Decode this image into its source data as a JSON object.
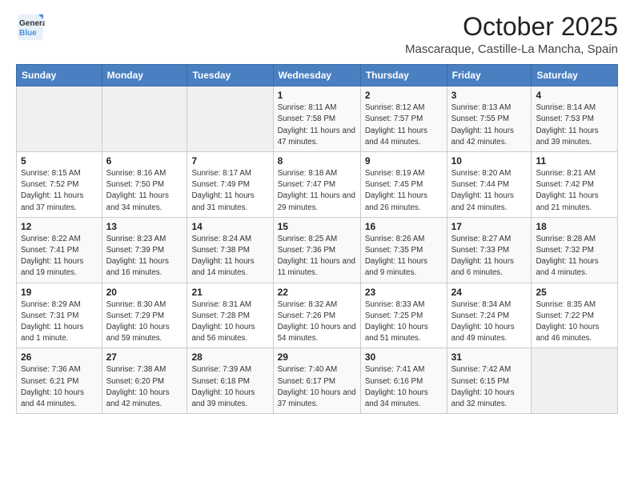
{
  "logo": {
    "line1": "General",
    "line2": "Blue"
  },
  "header": {
    "month": "October 2025",
    "location": "Mascaraque, Castille-La Mancha, Spain"
  },
  "weekdays": [
    "Sunday",
    "Monday",
    "Tuesday",
    "Wednesday",
    "Thursday",
    "Friday",
    "Saturday"
  ],
  "weeks": [
    [
      {
        "day": "",
        "info": ""
      },
      {
        "day": "",
        "info": ""
      },
      {
        "day": "",
        "info": ""
      },
      {
        "day": "1",
        "info": "Sunrise: 8:11 AM\nSunset: 7:58 PM\nDaylight: 11 hours and 47 minutes."
      },
      {
        "day": "2",
        "info": "Sunrise: 8:12 AM\nSunset: 7:57 PM\nDaylight: 11 hours and 44 minutes."
      },
      {
        "day": "3",
        "info": "Sunrise: 8:13 AM\nSunset: 7:55 PM\nDaylight: 11 hours and 42 minutes."
      },
      {
        "day": "4",
        "info": "Sunrise: 8:14 AM\nSunset: 7:53 PM\nDaylight: 11 hours and 39 minutes."
      }
    ],
    [
      {
        "day": "5",
        "info": "Sunrise: 8:15 AM\nSunset: 7:52 PM\nDaylight: 11 hours and 37 minutes."
      },
      {
        "day": "6",
        "info": "Sunrise: 8:16 AM\nSunset: 7:50 PM\nDaylight: 11 hours and 34 minutes."
      },
      {
        "day": "7",
        "info": "Sunrise: 8:17 AM\nSunset: 7:49 PM\nDaylight: 11 hours and 31 minutes."
      },
      {
        "day": "8",
        "info": "Sunrise: 8:18 AM\nSunset: 7:47 PM\nDaylight: 11 hours and 29 minutes."
      },
      {
        "day": "9",
        "info": "Sunrise: 8:19 AM\nSunset: 7:45 PM\nDaylight: 11 hours and 26 minutes."
      },
      {
        "day": "10",
        "info": "Sunrise: 8:20 AM\nSunset: 7:44 PM\nDaylight: 11 hours and 24 minutes."
      },
      {
        "day": "11",
        "info": "Sunrise: 8:21 AM\nSunset: 7:42 PM\nDaylight: 11 hours and 21 minutes."
      }
    ],
    [
      {
        "day": "12",
        "info": "Sunrise: 8:22 AM\nSunset: 7:41 PM\nDaylight: 11 hours and 19 minutes."
      },
      {
        "day": "13",
        "info": "Sunrise: 8:23 AM\nSunset: 7:39 PM\nDaylight: 11 hours and 16 minutes."
      },
      {
        "day": "14",
        "info": "Sunrise: 8:24 AM\nSunset: 7:38 PM\nDaylight: 11 hours and 14 minutes."
      },
      {
        "day": "15",
        "info": "Sunrise: 8:25 AM\nSunset: 7:36 PM\nDaylight: 11 hours and 11 minutes."
      },
      {
        "day": "16",
        "info": "Sunrise: 8:26 AM\nSunset: 7:35 PM\nDaylight: 11 hours and 9 minutes."
      },
      {
        "day": "17",
        "info": "Sunrise: 8:27 AM\nSunset: 7:33 PM\nDaylight: 11 hours and 6 minutes."
      },
      {
        "day": "18",
        "info": "Sunrise: 8:28 AM\nSunset: 7:32 PM\nDaylight: 11 hours and 4 minutes."
      }
    ],
    [
      {
        "day": "19",
        "info": "Sunrise: 8:29 AM\nSunset: 7:31 PM\nDaylight: 11 hours and 1 minute."
      },
      {
        "day": "20",
        "info": "Sunrise: 8:30 AM\nSunset: 7:29 PM\nDaylight: 10 hours and 59 minutes."
      },
      {
        "day": "21",
        "info": "Sunrise: 8:31 AM\nSunset: 7:28 PM\nDaylight: 10 hours and 56 minutes."
      },
      {
        "day": "22",
        "info": "Sunrise: 8:32 AM\nSunset: 7:26 PM\nDaylight: 10 hours and 54 minutes."
      },
      {
        "day": "23",
        "info": "Sunrise: 8:33 AM\nSunset: 7:25 PM\nDaylight: 10 hours and 51 minutes."
      },
      {
        "day": "24",
        "info": "Sunrise: 8:34 AM\nSunset: 7:24 PM\nDaylight: 10 hours and 49 minutes."
      },
      {
        "day": "25",
        "info": "Sunrise: 8:35 AM\nSunset: 7:22 PM\nDaylight: 10 hours and 46 minutes."
      }
    ],
    [
      {
        "day": "26",
        "info": "Sunrise: 7:36 AM\nSunset: 6:21 PM\nDaylight: 10 hours and 44 minutes."
      },
      {
        "day": "27",
        "info": "Sunrise: 7:38 AM\nSunset: 6:20 PM\nDaylight: 10 hours and 42 minutes."
      },
      {
        "day": "28",
        "info": "Sunrise: 7:39 AM\nSunset: 6:18 PM\nDaylight: 10 hours and 39 minutes."
      },
      {
        "day": "29",
        "info": "Sunrise: 7:40 AM\nSunset: 6:17 PM\nDaylight: 10 hours and 37 minutes."
      },
      {
        "day": "30",
        "info": "Sunrise: 7:41 AM\nSunset: 6:16 PM\nDaylight: 10 hours and 34 minutes."
      },
      {
        "day": "31",
        "info": "Sunrise: 7:42 AM\nSunset: 6:15 PM\nDaylight: 10 hours and 32 minutes."
      },
      {
        "day": "",
        "info": ""
      }
    ]
  ]
}
